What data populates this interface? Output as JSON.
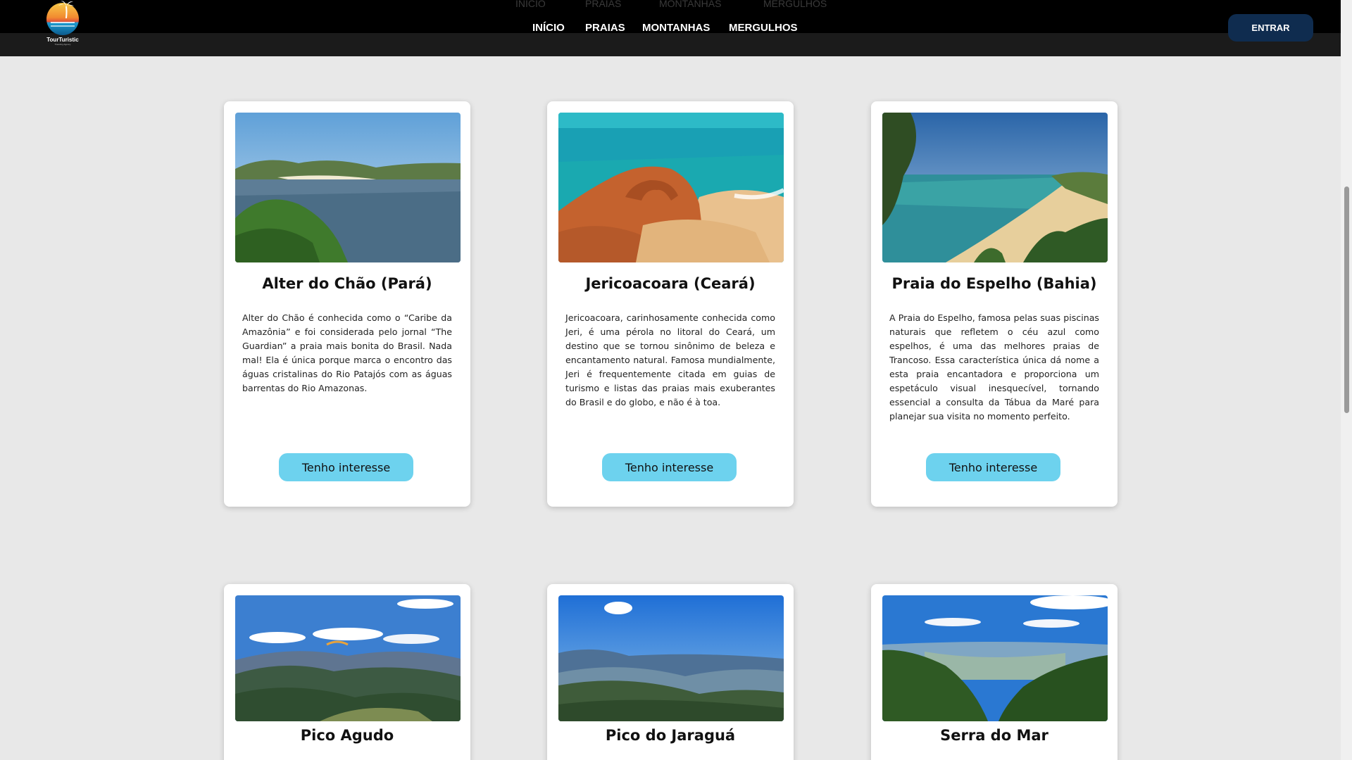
{
  "header": {
    "logo_name": "TourTuristic",
    "logo_tagline": "Traveling Agency",
    "nav": [
      "INÍCIO",
      "PRAIAS",
      "MONTANHAS",
      "MERGULHOS"
    ],
    "enter_label": "ENTRAR"
  },
  "cards": [
    {
      "title": "Alter do Chão (Pará)",
      "text": "Alter do Chão é conhecida como o “Caribe da Amazônia” e foi considerada pelo jornal “The Guardian” a praia mais bonita do Brasil. Nada mal! Ela é única porque marca o encontro das águas cristalinas do Rio Patajós com as águas barrentas do Rio Amazonas.",
      "button": "Tenho interesse"
    },
    {
      "title": "Jericoacoara (Ceará)",
      "text": "Jericoacoara, carinhosamente conhecida como Jeri, é uma pérola no litoral do Ceará, um destino que se tornou sinônimo de beleza e encantamento natural. Famosa mundialmente, Jeri é frequentemente citada em guias de turismo e listas das praias mais exuberantes do Brasil e do globo, e não é à toa.",
      "button": "Tenho interesse"
    },
    {
      "title": "Praia do Espelho (Bahia)",
      "text": "A Praia do Espelho, famosa pelas suas piscinas naturais que refletem o céu azul como espelhos, é uma das melhores praias de Trancoso. Essa característica única dá nome a esta praia encantadora e proporciona um espetáculo visual inesquecível, tornando essencial a consulta da Tábua da Maré para planejar sua visita no momento perfeito.",
      "button": "Tenho interesse"
    },
    {
      "title": "Pico Agudo"
    },
    {
      "title": "Pico do Jaraguá"
    },
    {
      "title": "Serra do Mar"
    }
  ],
  "colors": {
    "header_bg": "#000000",
    "enter_button": "#0f2c4f",
    "interest_button": "#6dd2ee",
    "page_bg": "#e8e8e8"
  }
}
